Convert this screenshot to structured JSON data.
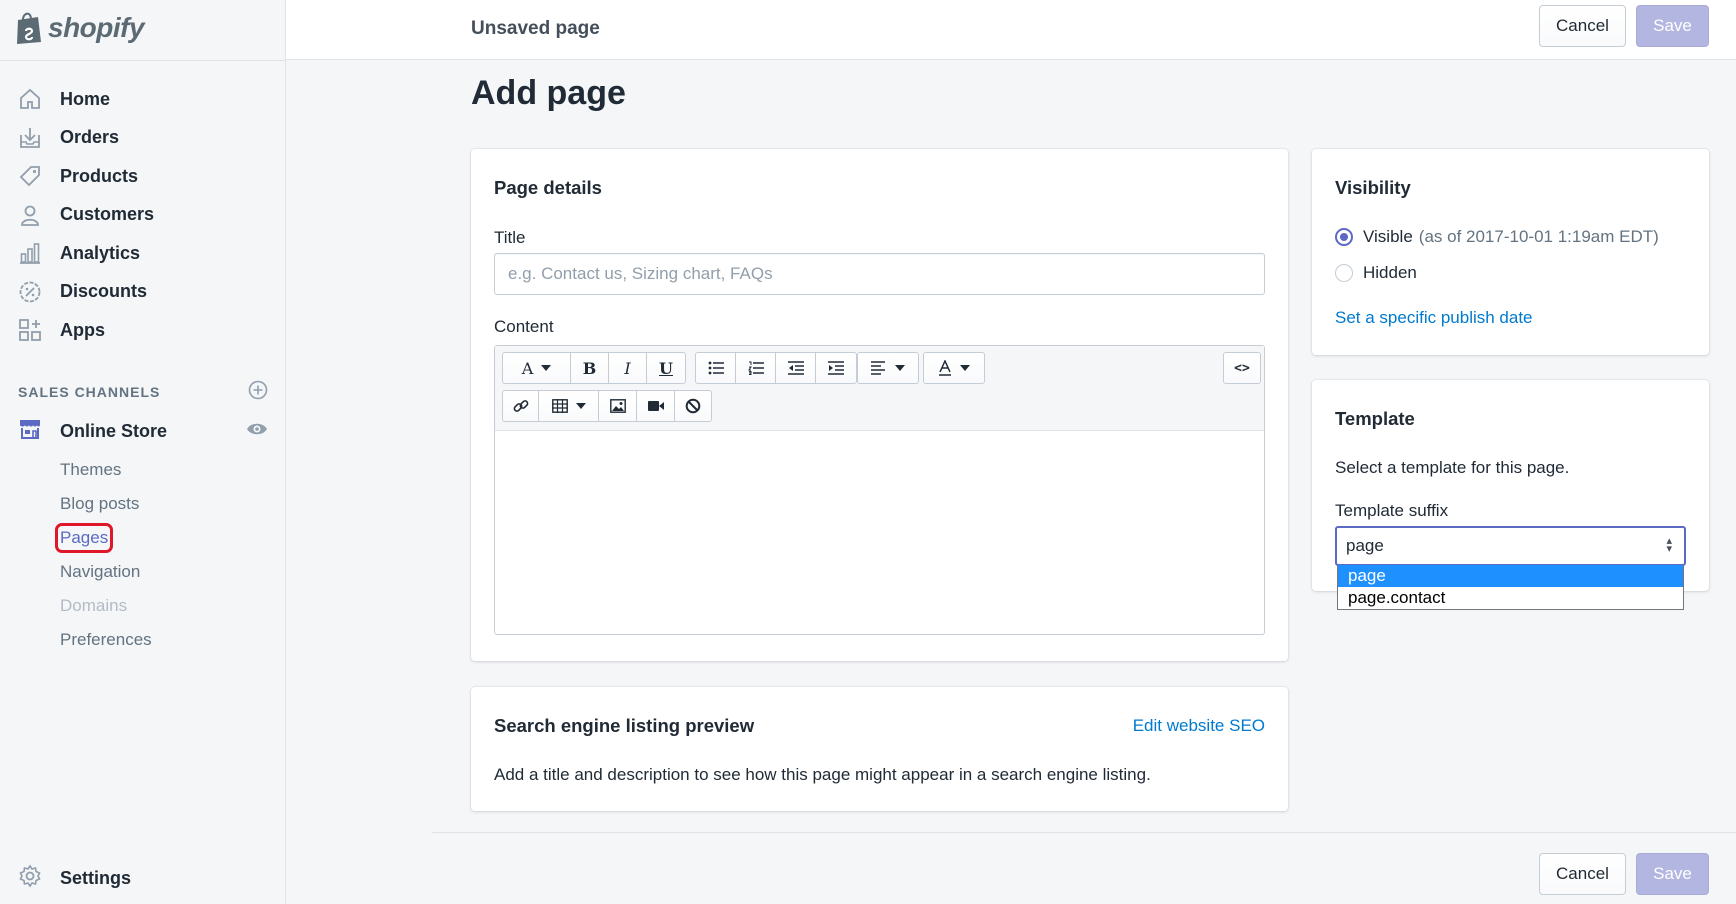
{
  "brand": {
    "name": "shopify"
  },
  "sidebar": {
    "items": [
      {
        "label": "Home",
        "icon": "home-icon"
      },
      {
        "label": "Orders",
        "icon": "orders-icon"
      },
      {
        "label": "Products",
        "icon": "tag-icon"
      },
      {
        "label": "Customers",
        "icon": "person-icon"
      },
      {
        "label": "Analytics",
        "icon": "bar-chart-icon"
      },
      {
        "label": "Discounts",
        "icon": "discount-icon"
      },
      {
        "label": "Apps",
        "icon": "apps-icon"
      }
    ],
    "sales_channels_heading": "SALES CHANNELS",
    "online_store": "Online Store",
    "sub_items": [
      "Themes",
      "Blog posts",
      "Pages",
      "Navigation",
      "Domains",
      "Preferences"
    ],
    "settings": "Settings"
  },
  "topbar": {
    "title": "Unsaved page",
    "cancel": "Cancel",
    "save": "Save"
  },
  "page": {
    "title": "Add page"
  },
  "details": {
    "heading": "Page details",
    "title_label": "Title",
    "title_placeholder": "e.g. Contact us, Sizing chart, FAQs",
    "content_label": "Content",
    "toolbar_row1": [
      "A",
      "B",
      "I",
      "U",
      "bullet-list",
      "numbered-list",
      "outdent",
      "indent",
      "align",
      "text-color"
    ],
    "toolbar_row2": [
      "link",
      "table",
      "image",
      "video",
      "clear-format"
    ],
    "html_toggle": "<>"
  },
  "seo": {
    "heading": "Search engine listing preview",
    "edit_link": "Edit website SEO",
    "description": "Add a title and description to see how this page might appear in a search engine listing."
  },
  "visibility": {
    "heading": "Visibility",
    "visible_label": "Visible",
    "visible_note": "(as of 2017-10-01 1:19am EDT)",
    "hidden_label": "Hidden",
    "selected": "Visible",
    "publish_link": "Set a specific publish date"
  },
  "template": {
    "heading": "Template",
    "description": "Select a template for this page.",
    "suffix_label": "Template suffix",
    "selected": "page",
    "options": [
      "page",
      "page.contact"
    ]
  },
  "footer": {
    "cancel": "Cancel",
    "save": "Save"
  },
  "colors": {
    "accent": "#5c6ac4",
    "link": "#007ace",
    "highlight_box": "#e0162b",
    "dropdown_selected": "#1e90ff"
  }
}
